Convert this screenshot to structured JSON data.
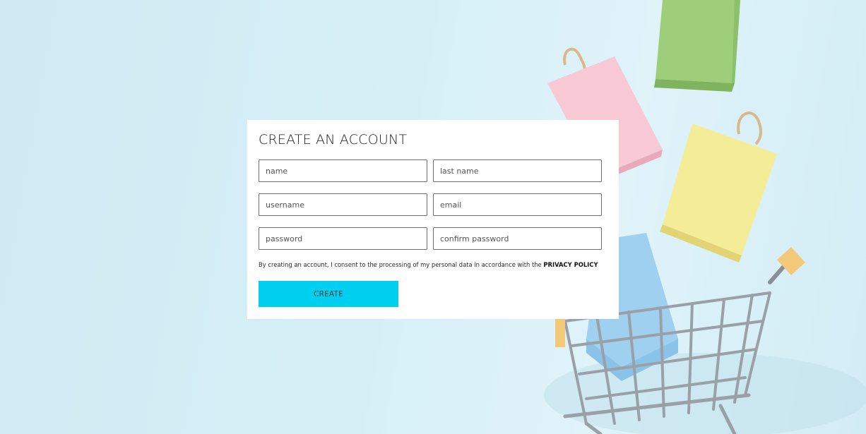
{
  "form": {
    "title": "CREATE AN ACCOUNT",
    "fields": {
      "name": "name",
      "last_name": "last name",
      "username": "username",
      "email": "email",
      "password": "password",
      "confirm_password": "confirm password"
    },
    "consent_text": "By creating an account, I consent to the processing of my personal data in accordance with the ",
    "privacy_policy_label": "PRIVACY POLICY",
    "create_label": "CREATE"
  },
  "colors": {
    "background": "#d6eff7",
    "button": "#00cfef",
    "card": "#ffffff"
  }
}
